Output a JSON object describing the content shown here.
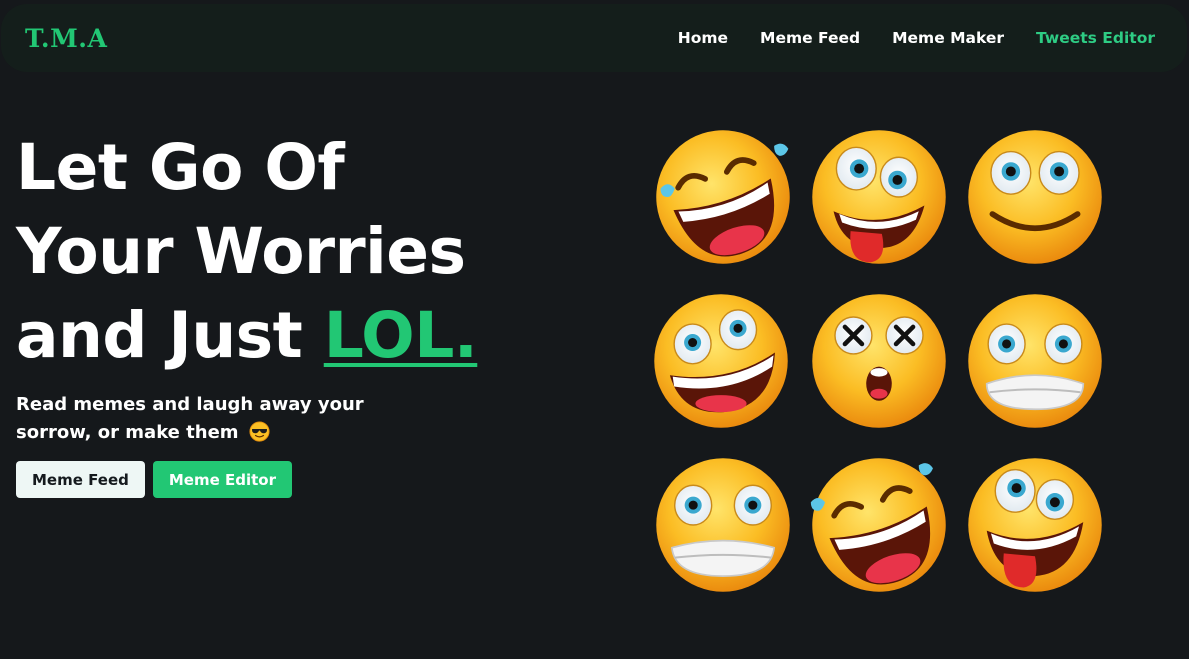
{
  "nav": {
    "logo": "T.M.A",
    "links": [
      {
        "label": "Home",
        "active": false
      },
      {
        "label": "Meme Feed",
        "active": false
      },
      {
        "label": "Meme Maker",
        "active": false
      },
      {
        "label": "Tweets Editor",
        "active": true
      }
    ]
  },
  "hero": {
    "title_line1": "Let Go Of",
    "title_line2": "Your Worries",
    "title_line3_prefix": "and Just ",
    "title_accent": "LOL.",
    "subtitle": "Read memes and laugh away your sorrow, or make them",
    "subtitle_emoji": "smiling-face-with-sunglasses-icon",
    "buttons": [
      {
        "label": "Meme Feed"
      },
      {
        "label": "Meme Editor"
      }
    ]
  },
  "emojis": [
    "rolling-laughing-emoji-icon",
    "crazy-tongue-emoji-icon",
    "wide-eyed-smile-emoji-icon",
    "grinning-wide-eyes-emoji-icon",
    "dizzy-face-emoji-icon",
    "grimacing-emoji-icon",
    "grimacing-wide-eyes-emoji-icon",
    "rolling-laughing-emoji-icon",
    "crazy-tongue-emoji-icon"
  ],
  "colors": {
    "background": "#15181b",
    "navbar": "#141e1b",
    "accent": "#22c774",
    "button_light": "#eef7f5"
  }
}
